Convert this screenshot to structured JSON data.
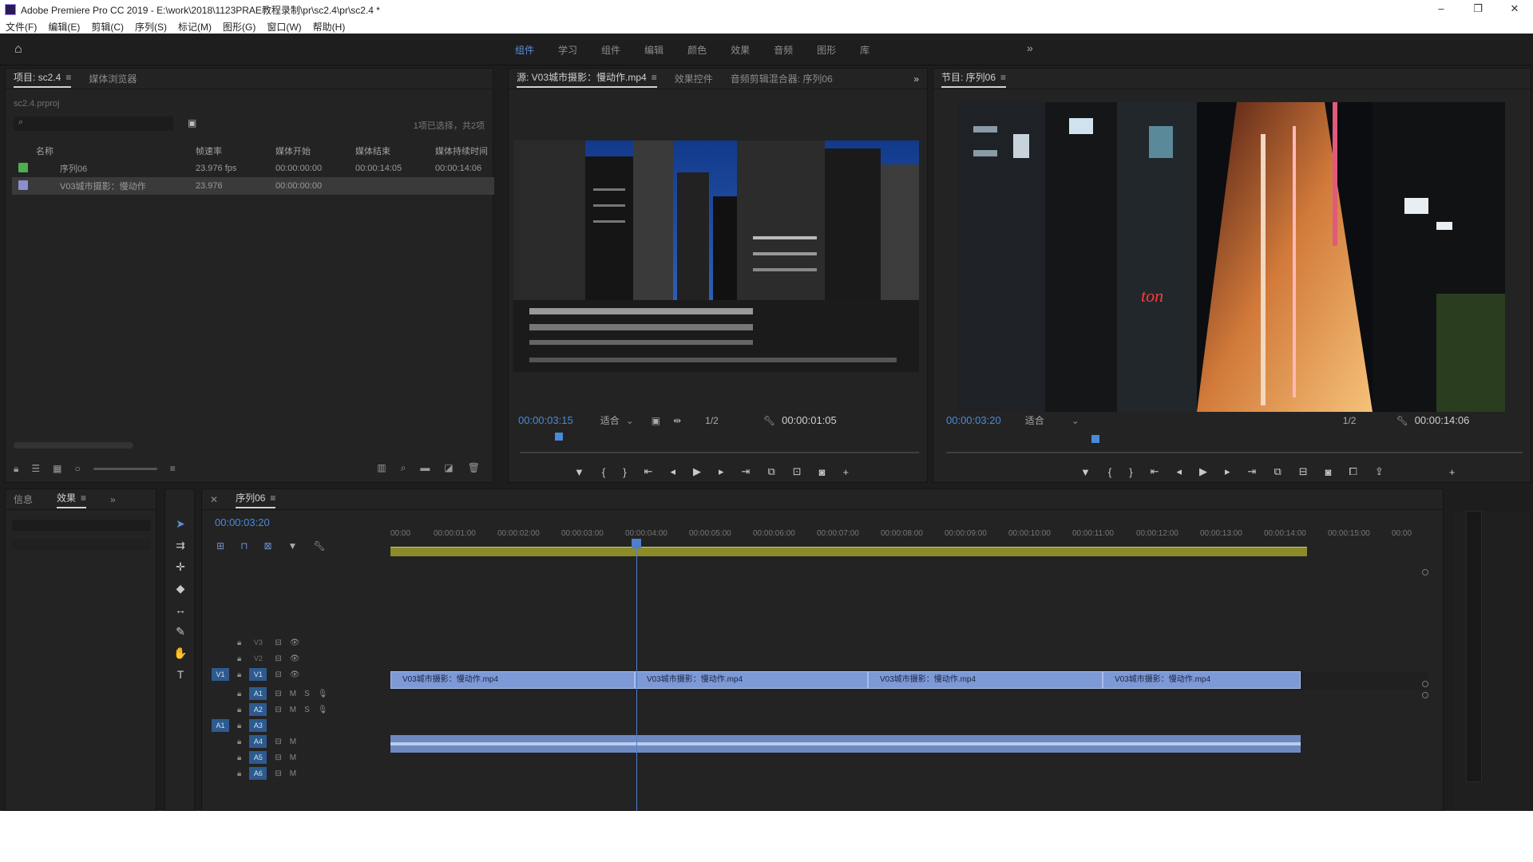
{
  "window": {
    "title": "Adobe Premiere Pro CC 2019 - E:\\work\\2018\\1123PRAE教程录制\\pr\\sc2.4\\pr\\sc2.4 *",
    "minimize": "–",
    "restore": "❐",
    "close": "✕"
  },
  "menu": [
    "文件(F)",
    "编辑(E)",
    "剪辑(C)",
    "序列(S)",
    "标记(M)",
    "图形(G)",
    "窗口(W)",
    "帮助(H)"
  ],
  "workspaces": {
    "items": [
      "组件",
      "学习",
      "组件",
      "编辑",
      "颜色",
      "效果",
      "音频",
      "图形",
      "库"
    ],
    "active_index": 0,
    "more": "»"
  },
  "project": {
    "tab_project": "项目: sc2.4",
    "tab_media": "媒体浏览器",
    "path": "sc2.4.prproj",
    "selection_count": "1项已选择，共2项",
    "columns": [
      "名称",
      "帧速率",
      "媒体开始",
      "媒体结束",
      "媒体持续时间"
    ],
    "rows": [
      {
        "name": "序列06",
        "fps": "23.976 fps",
        "start": "00:00:00:00",
        "end": "00:00:14:05",
        "dur": "00:00:14:06",
        "color": "#4caf50",
        "selected": false
      },
      {
        "name": "V03城市摄影：慢动作",
        "fps": "23.976",
        "start": "00:00:00:00",
        "end": "",
        "dur": "",
        "color": "#8a8fd0",
        "selected": true
      }
    ]
  },
  "source": {
    "tab_source": "源: V03城市摄影：慢动作.mp4",
    "tab_fx": "效果控件",
    "tab_mixer": "音频剪辑混合器: 序列06",
    "more": "»",
    "timecode": "00:00:03:15",
    "fit": "适合",
    "resolution": "1/2",
    "duration": "00:00:01:05"
  },
  "program": {
    "tab": "节目: 序列06",
    "timecode": "00:00:03:20",
    "fit": "适合",
    "resolution": "1/2",
    "duration": "00:00:14:06"
  },
  "effects": {
    "tab_info": "信息",
    "tab_effects": "效果",
    "more": "»"
  },
  "timeline": {
    "tab": "序列06",
    "timecode": "00:00:03:20",
    "ruler": [
      "00:00",
      "00:00:01:00",
      "00:00:02:00",
      "00:00:03:00",
      "00:00:04:00",
      "00:00:05:00",
      "00:00:06:00",
      "00:00:07:00",
      "00:00:08:00",
      "00:00:09:00",
      "00:00:10:00",
      "00:00:11:00",
      "00:00:12:00",
      "00:00:13:00",
      "00:00:14:00",
      "00:00:15:00",
      "00:00"
    ],
    "video_tracks": [
      "V3",
      "V2",
      "V1"
    ],
    "audio_tracks": [
      "A1",
      "A2",
      "A3",
      "A4",
      "A5",
      "A6"
    ],
    "clips": [
      "V03城市摄影：慢动作.mp4",
      "V03城市摄影：慢动作.mp4",
      "V03城市摄影：慢动作.mp4",
      "V03城市摄影：慢动作.mp4"
    ],
    "target_v": "V1",
    "target_a": "A1"
  },
  "colors": {
    "accent": "#4a8ad8",
    "clip": "#7d99d6",
    "workarea": "#8b8b2a"
  }
}
